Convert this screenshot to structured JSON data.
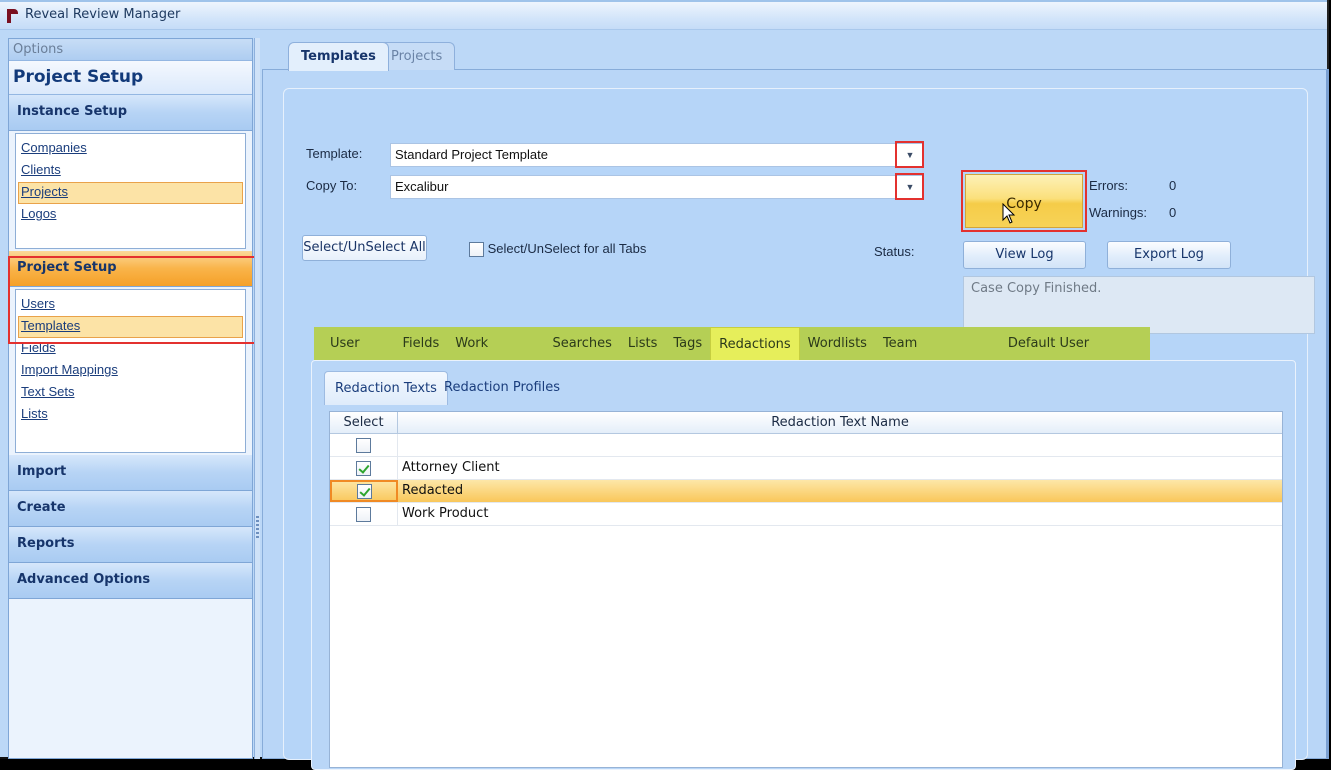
{
  "app": {
    "title": "Reveal Review Manager",
    "logo_icon": "reveal-logo-icon"
  },
  "sidebar": {
    "options_label": "Options",
    "title": "Project Setup",
    "groups": [
      {
        "label": "Instance Setup",
        "active": false,
        "items": [
          {
            "label": "Companies",
            "selected": false
          },
          {
            "label": "Clients",
            "selected": false
          },
          {
            "label": "Projects",
            "selected": true
          },
          {
            "label": "Logos",
            "selected": false
          }
        ]
      },
      {
        "label": "Project Setup",
        "active": true,
        "items": [
          {
            "label": "Users",
            "selected": false
          },
          {
            "label": "Templates",
            "selected": true
          },
          {
            "label": "Fields",
            "selected": false
          },
          {
            "label": "Import Mappings",
            "selected": false
          },
          {
            "label": "Text Sets",
            "selected": false
          },
          {
            "label": "Lists",
            "selected": false
          }
        ]
      },
      {
        "label": "Import"
      },
      {
        "label": "Create"
      },
      {
        "label": "Reports"
      },
      {
        "label": "Advanced Options"
      }
    ]
  },
  "main": {
    "tabs": [
      {
        "label": "Templates",
        "active": true
      },
      {
        "label": "Projects",
        "active": false
      }
    ],
    "template_label": "Template:",
    "template_value": "Standard Project Template",
    "copy_to_label": "Copy To:",
    "copy_to_value": "Excalibur",
    "copy_button": "Copy",
    "errors_label": "Errors:",
    "errors_value": "0",
    "warnings_label": "Warnings:",
    "warnings_value": "0",
    "view_log_button": "View Log",
    "export_log_button": "Export Log",
    "select_all_button": "Select/UnSelect All",
    "select_all_tabs_label": "Select/UnSelect for all Tabs",
    "select_all_tabs_checked": false,
    "status_label": "Status:",
    "status_text": "Case Copy Finished.",
    "section_tabs": [
      {
        "label": "User Info"
      },
      {
        "label": "Fields"
      },
      {
        "label": "Work Folders"
      },
      {
        "label": "Searches"
      },
      {
        "label": "Lists"
      },
      {
        "label": "Tags"
      },
      {
        "label": "Redactions",
        "active": true
      },
      {
        "label": "Wordlists"
      },
      {
        "label": "Team Documents"
      },
      {
        "label": "Default User Settings"
      }
    ],
    "sub_tabs": [
      {
        "label": "Redaction Texts",
        "active": true
      },
      {
        "label": "Redaction Profiles",
        "active": false
      }
    ],
    "grid": {
      "columns": [
        "Select",
        "Redaction Text Name"
      ],
      "rows": [
        {
          "checked": false,
          "name": ""
        },
        {
          "checked": true,
          "name": "Attorney Client"
        },
        {
          "checked": true,
          "name": "Redacted",
          "selected": true
        },
        {
          "checked": false,
          "name": "Work Product"
        }
      ]
    }
  },
  "colors": {
    "accent_orange": "#f9b44a",
    "highlight_red": "#e3312f",
    "tab_strip_green": "#b5cf55",
    "active_tab_yellow": "#e6ee5b"
  }
}
